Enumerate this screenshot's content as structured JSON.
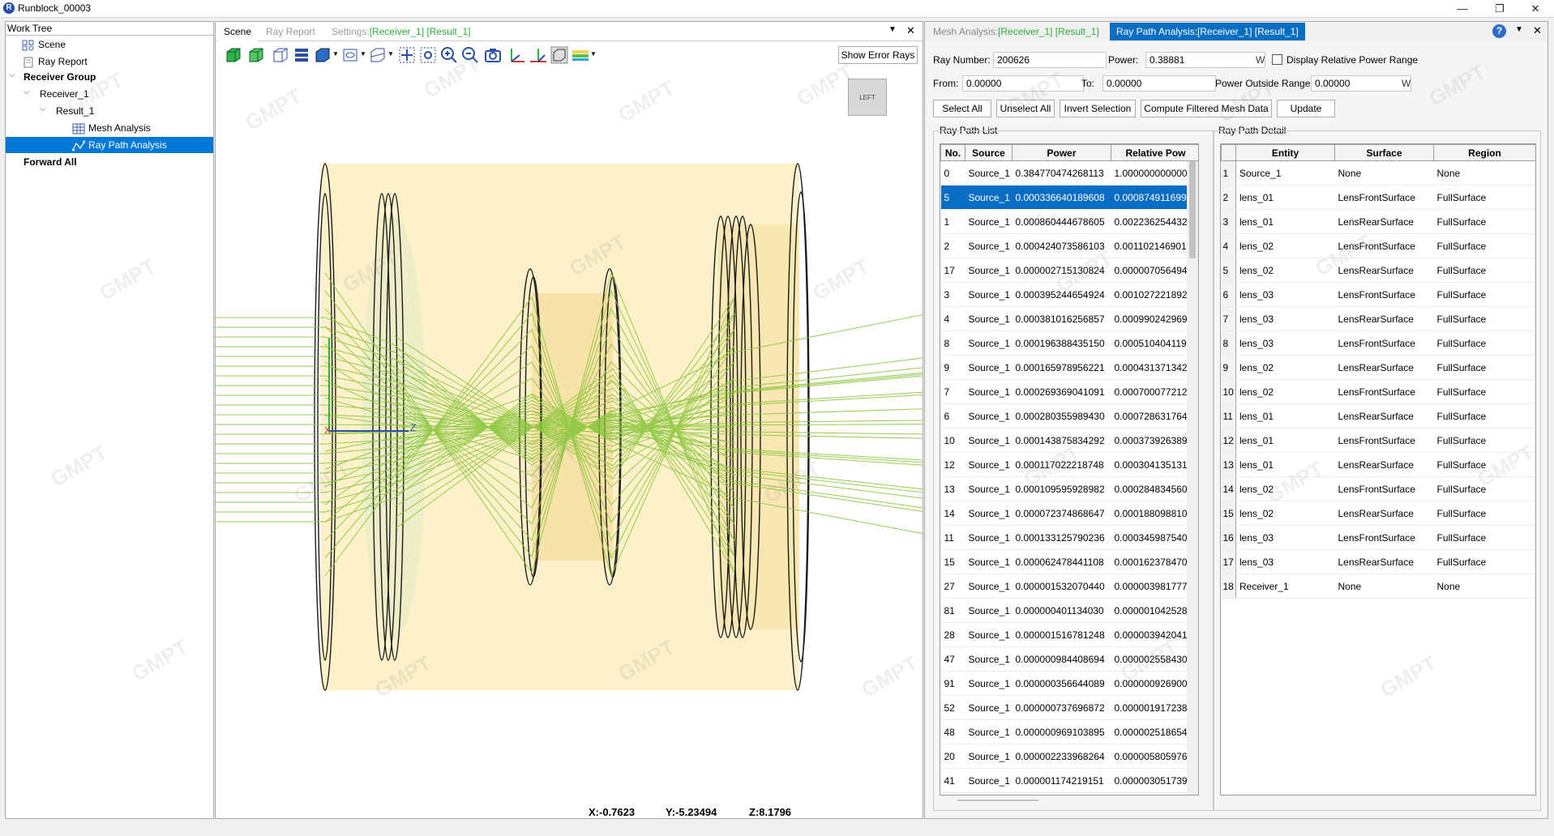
{
  "window": {
    "app_icon_letter": "R",
    "title": "Runblock_00003",
    "minimize_glyph": "—",
    "maximize_glyph": "❐",
    "close_glyph": "✕"
  },
  "work_tree": {
    "header": "Work Tree",
    "nodes": {
      "scene": "Scene",
      "ray_report": "Ray Report",
      "receiver_group": "Receiver Group",
      "receiver_1": "Receiver_1",
      "result_1": "Result_1",
      "mesh_analysis": "Mesh Analysis",
      "ray_path_analysis": "Ray Path Analysis",
      "forward_all": "Forward All"
    }
  },
  "scene_panel": {
    "tabs": {
      "scene": "Scene",
      "ray_report": "Ray Report",
      "settings_prefix": "Settings:",
      "settings_receiver": "[Receiver_1]",
      "settings_result": "[Result_1]"
    },
    "show_error_rays": "Show Error Rays",
    "view_cube_label": "LEFT",
    "coords": {
      "x": "X:-0.7623",
      "y": "Y:-5.23494",
      "z": "Z:8.1796"
    },
    "watermark": "GMPT"
  },
  "analysis_panel": {
    "tabs": {
      "mesh_prefix": "Mesh Analysis:",
      "mesh_receiver": "[Receiver_1]",
      "mesh_result": "[Result_1]",
      "raypath": "Ray Path Analysis:[Receiver_1] [Result_1]"
    },
    "help_glyph": "?",
    "form": {
      "ray_number_label": "Ray Number:",
      "ray_number_value": "200626",
      "power_label": "Power:",
      "power_value": "0.38881",
      "power_unit": "W",
      "display_relative_label": "Display Relative Power Range",
      "from_label": "From:",
      "from_value": "0.00000",
      "to_label": "To:",
      "to_value": "0.00000",
      "outside_label": "Power Outside Range:",
      "outside_value": "0.00000",
      "outside_unit": "W"
    },
    "buttons": {
      "select_all": "Select All",
      "unselect_all": "Unselect All",
      "invert_selection": "Invert Selection",
      "compute_filtered": "Compute Filtered Mesh Data",
      "update": "Update"
    },
    "ray_path_list": {
      "title": "Ray Path List",
      "columns": [
        "No.",
        "Source",
        "Power",
        "Relative Pow"
      ],
      "rows": [
        [
          "0",
          "Source_1",
          "0.384770474268113",
          "1.000000000000"
        ],
        [
          "5",
          "Source_1",
          "0.000336640189608",
          "0.000874911699"
        ],
        [
          "1",
          "Source_1",
          "0.000860444678605",
          "0.002236254432"
        ],
        [
          "2",
          "Source_1",
          "0.000424073586103",
          "0.001102146901"
        ],
        [
          "17",
          "Source_1",
          "0.000002715130824",
          "0.000007056494"
        ],
        [
          "3",
          "Source_1",
          "0.000395244654924",
          "0.001027221892"
        ],
        [
          "4",
          "Source_1",
          "0.000381016256857",
          "0.000990242969"
        ],
        [
          "8",
          "Source_1",
          "0.000196388435150",
          "0.000510404119"
        ],
        [
          "9",
          "Source_1",
          "0.000165978956221",
          "0.000431371342"
        ],
        [
          "7",
          "Source_1",
          "0.000269369041091",
          "0.000700077212"
        ],
        [
          "6",
          "Source_1",
          "0.000280355989430",
          "0.000728631764"
        ],
        [
          "10",
          "Source_1",
          "0.000143875834292",
          "0.000373926389"
        ],
        [
          "12",
          "Source_1",
          "0.000117022218748",
          "0.000304135131"
        ],
        [
          "13",
          "Source_1",
          "0.000109595928982",
          "0.000284834560"
        ],
        [
          "14",
          "Source_1",
          "0.000072374868647",
          "0.000188098810"
        ],
        [
          "11",
          "Source_1",
          "0.000133125790236",
          "0.000345987540"
        ],
        [
          "15",
          "Source_1",
          "0.000062478441108",
          "0.000162378470"
        ],
        [
          "27",
          "Source_1",
          "0.000001532070440",
          "0.000003981777"
        ],
        [
          "81",
          "Source_1",
          "0.000000401134030",
          "0.000001042528"
        ],
        [
          "28",
          "Source_1",
          "0.000001516781248",
          "0.000003942041"
        ],
        [
          "47",
          "Source_1",
          "0.000000984408694",
          "0.000002558430"
        ],
        [
          "91",
          "Source_1",
          "0.000000356644089",
          "0.000000926900"
        ],
        [
          "52",
          "Source_1",
          "0.000000737696872",
          "0.000001917238"
        ],
        [
          "48",
          "Source_1",
          "0.000000969103895",
          "0.000002518654"
        ],
        [
          "20",
          "Source_1",
          "0.000002233968264",
          "0.000005805976"
        ],
        [
          "41",
          "Source_1",
          "0.000001174219151",
          "0.000003051739"
        ]
      ]
    },
    "ray_path_detail": {
      "title": "Ray Path Detail",
      "columns": [
        "Entity",
        "Surface",
        "Region"
      ],
      "rows": [
        [
          "1",
          "Source_1",
          "None",
          "None"
        ],
        [
          "2",
          "lens_01",
          "LensFrontSurface",
          "FullSurface"
        ],
        [
          "3",
          "lens_01",
          "LensRearSurface",
          "FullSurface"
        ],
        [
          "4",
          "lens_02",
          "LensFrontSurface",
          "FullSurface"
        ],
        [
          "5",
          "lens_02",
          "LensRearSurface",
          "FullSurface"
        ],
        [
          "6",
          "lens_03",
          "LensFrontSurface",
          "FullSurface"
        ],
        [
          "7",
          "lens_03",
          "LensRearSurface",
          "FullSurface"
        ],
        [
          "8",
          "lens_03",
          "LensFrontSurface",
          "FullSurface"
        ],
        [
          "9",
          "lens_02",
          "LensRearSurface",
          "FullSurface"
        ],
        [
          "10",
          "lens_02",
          "LensFrontSurface",
          "FullSurface"
        ],
        [
          "11",
          "lens_01",
          "LensRearSurface",
          "FullSurface"
        ],
        [
          "12",
          "lens_01",
          "LensFrontSurface",
          "FullSurface"
        ],
        [
          "13",
          "lens_01",
          "LensRearSurface",
          "FullSurface"
        ],
        [
          "14",
          "lens_02",
          "LensFrontSurface",
          "FullSurface"
        ],
        [
          "15",
          "lens_02",
          "LensRearSurface",
          "FullSurface"
        ],
        [
          "16",
          "lens_03",
          "LensFrontSurface",
          "FullSurface"
        ],
        [
          "17",
          "lens_03",
          "LensRearSurface",
          "FullSurface"
        ],
        [
          "18",
          "Receiver_1",
          "None",
          "None"
        ]
      ]
    }
  },
  "colors": {
    "accent": "#0a6dc4",
    "tab_green": "#2eaa3c",
    "lens_fill": "#fbeec0",
    "ray_green": "#8cc63f"
  }
}
